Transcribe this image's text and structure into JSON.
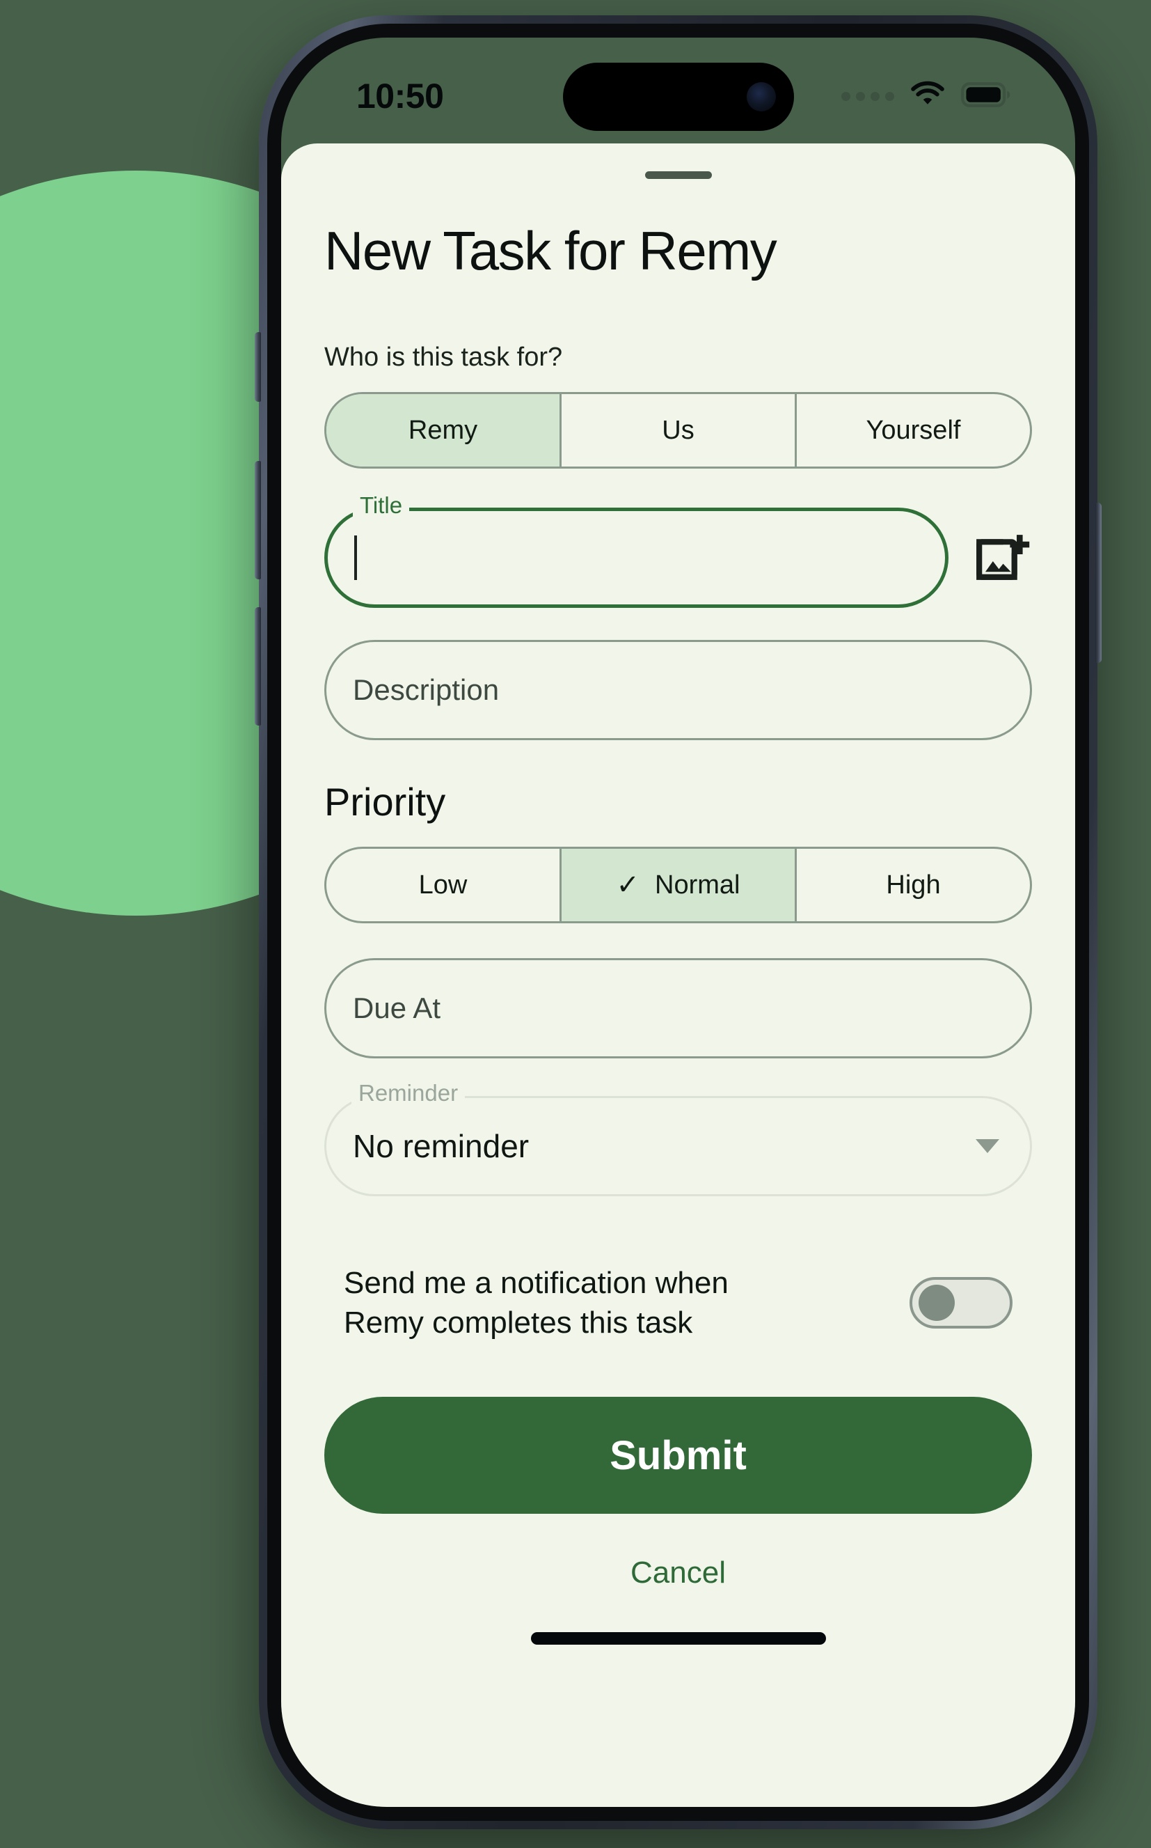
{
  "status_bar": {
    "time": "10:50",
    "icons": [
      "cellular-dots",
      "wifi-icon",
      "battery-icon"
    ]
  },
  "sheet": {
    "title": "New Task for Remy",
    "audience_label": "Who is this task for?",
    "audience_options": [
      {
        "label": "Remy",
        "selected": true
      },
      {
        "label": "Us",
        "selected": false
      },
      {
        "label": "Yourself",
        "selected": false
      }
    ],
    "title_field": {
      "label": "Title",
      "value": "",
      "focused": true
    },
    "add_image_icon": "add-photo-icon",
    "description_field": {
      "placeholder": "Description",
      "value": ""
    },
    "priority_heading": "Priority",
    "priority_options": [
      {
        "label": "Low",
        "selected": false,
        "check": ""
      },
      {
        "label": "Normal",
        "selected": true,
        "check": "✓"
      },
      {
        "label": "High",
        "selected": false,
        "check": ""
      }
    ],
    "due_at_field": {
      "placeholder": "Due At",
      "value": ""
    },
    "reminder_select": {
      "label": "Reminder",
      "value": "No reminder",
      "caret": "chevron-down-icon"
    },
    "notification": {
      "text": "Send me a notification when Remy completes this task",
      "enabled": false
    },
    "submit_label": "Submit",
    "cancel_label": "Cancel"
  },
  "colors": {
    "screen_background": "#47604a",
    "sheet_background": "#f2f5ea",
    "accent_green": "#2f7038",
    "submit_green": "#336938",
    "selected_segment": "#d3e6d0",
    "decor_circle": "#7dd08d",
    "border_grey": "#8a9a8c"
  }
}
